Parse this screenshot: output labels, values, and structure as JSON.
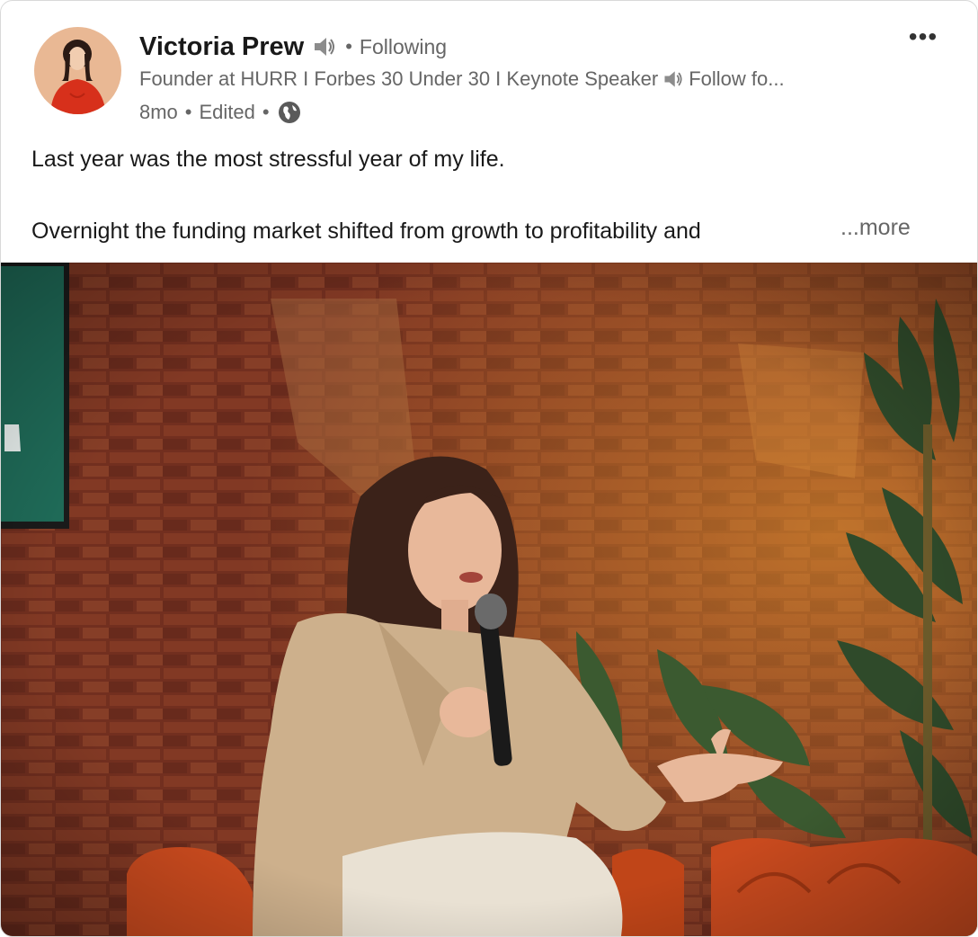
{
  "post": {
    "author": {
      "name": "Victoria Prew",
      "badge_icon": "speaker-emoji-icon",
      "connection_status": "Following",
      "headline_text": "Founder at HURR I Forbes 30 Under 30 I Keynote Speaker",
      "headline_tail": "Follow fo..."
    },
    "meta": {
      "age": "8mo",
      "edited": "Edited",
      "separator": "•",
      "visibility_icon": "globe-icon"
    },
    "menu_label": "•••",
    "text": {
      "paragraph1": "Last year was the most stressful year of my life.",
      "paragraph2": "Overnight the funding market shifted from growth to profitability and",
      "more_label": "...more"
    },
    "image": {
      "description_icon": "photo-speaker-on-stage"
    }
  },
  "colors": {
    "text_primary": "#191919",
    "text_secondary": "#666666",
    "card_border": "#d9d9d9",
    "avatar_bg": "#e9b894",
    "brick": "#8a3a26",
    "sofa": "#c94a1e",
    "blazer": "#cdb08c",
    "plant": "#2f4a2a"
  }
}
